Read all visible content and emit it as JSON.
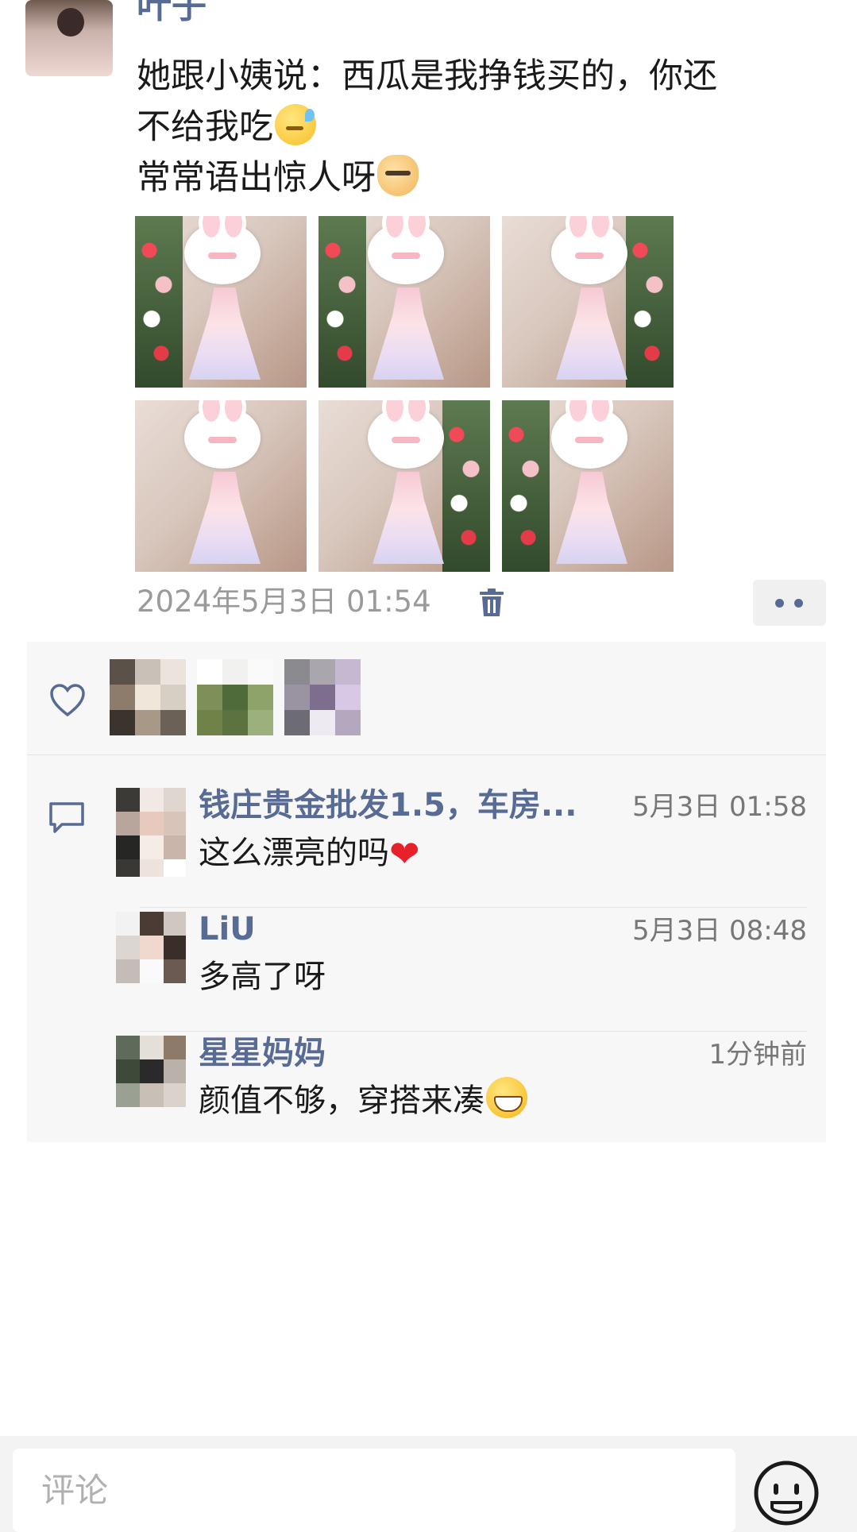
{
  "post": {
    "author": "叶子",
    "text_line1": "她跟小姨说：西瓜是我挣钱买的，你还",
    "text_line2": "不给我吃",
    "text_line3": "常常语出惊人呀",
    "emoji_1": "sweat-smile-emoji-icon",
    "emoji_2": "dog-face-emoji-icon",
    "photo_count": 6,
    "timestamp": "2024年5月3日 01:54"
  },
  "likes": {
    "icon": "heart-outline-icon",
    "avatar_count": 3
  },
  "comments": [
    {
      "name": "钱庄贵金批发1.5，车房...",
      "time": "5月3日 01:58",
      "text": "这么漂亮的吗"
    },
    {
      "name": "LiU",
      "time": "5月3日 08:48",
      "text": "多高了呀"
    },
    {
      "name": "星星妈妈",
      "time": "1分钟前",
      "text": "颜值不够，穿搭来凑"
    }
  ],
  "bottom": {
    "input_placeholder": "评论"
  },
  "colors": {
    "link_blue": "#576b95",
    "meta_gray": "#9a9a9a",
    "panel_bg": "#f7f7f7",
    "heart_red": "#e8202a"
  }
}
